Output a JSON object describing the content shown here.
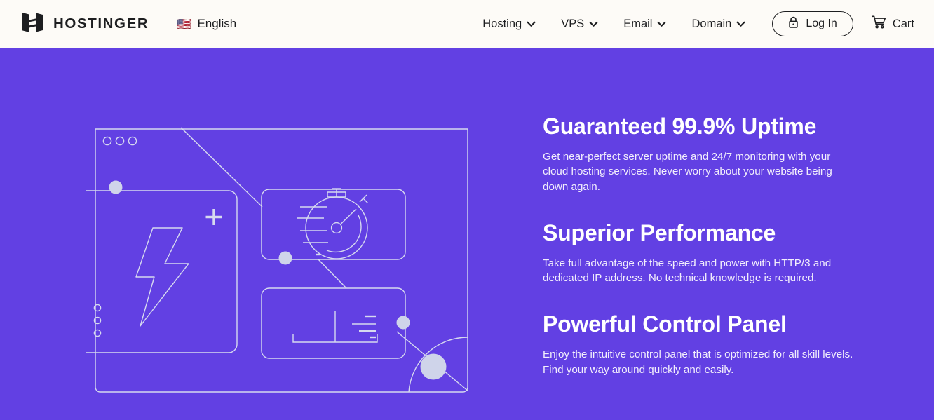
{
  "header": {
    "brand": {
      "logo_icon": "hostinger-h-logo-icon",
      "wordmark": "HOSTINGER"
    },
    "language": {
      "flag_icon": "us-flag-icon",
      "flag": "🇺🇸",
      "label": "English"
    },
    "nav": [
      {
        "label": "Hosting",
        "icon": "chevron-down-icon"
      },
      {
        "label": "VPS",
        "icon": "chevron-down-icon"
      },
      {
        "label": "Email",
        "icon": "chevron-down-icon"
      },
      {
        "label": "Domain",
        "icon": "chevron-down-icon"
      }
    ],
    "login": {
      "label": "Log In",
      "icon": "lock-icon"
    },
    "cart": {
      "label": "Cart",
      "icon": "shopping-cart-icon"
    },
    "background_color": "#fdfbf7",
    "text_color": "#1d1e20"
  },
  "hero": {
    "background_color": "#6240e3",
    "illustration": {
      "name": "cloud-hosting-line-illustration",
      "elements": [
        "browser-window-frame",
        "traffic-light-dots",
        "lightning-bolt-icon",
        "plus-icon",
        "vertical-dots-icon",
        "stopwatch-icon",
        "dashboard-chart-icon",
        "accent-dot-small",
        "accent-dot-large",
        "arc-line",
        "diagonal-connector-lines"
      ],
      "stroke_color": "#d6d9ef",
      "accent_fill_color": "#cfd4ea"
    },
    "features": [
      {
        "title": "Guaranteed 99.9% Uptime",
        "description": "Get near-perfect server uptime and 24/7 monitoring with your cloud hosting services. Never worry about your website being down again."
      },
      {
        "title": "Superior Performance",
        "description": "Take full advantage of the speed and power with HTTP/3 and dedicated IP address. No technical knowledge is required."
      },
      {
        "title": "Powerful Control Panel",
        "description": "Enjoy the intuitive control panel that is optimized for all skill levels. Find your way around quickly and easily."
      }
    ],
    "heading_color": "#ffffff",
    "body_color": "#f2eefc"
  }
}
